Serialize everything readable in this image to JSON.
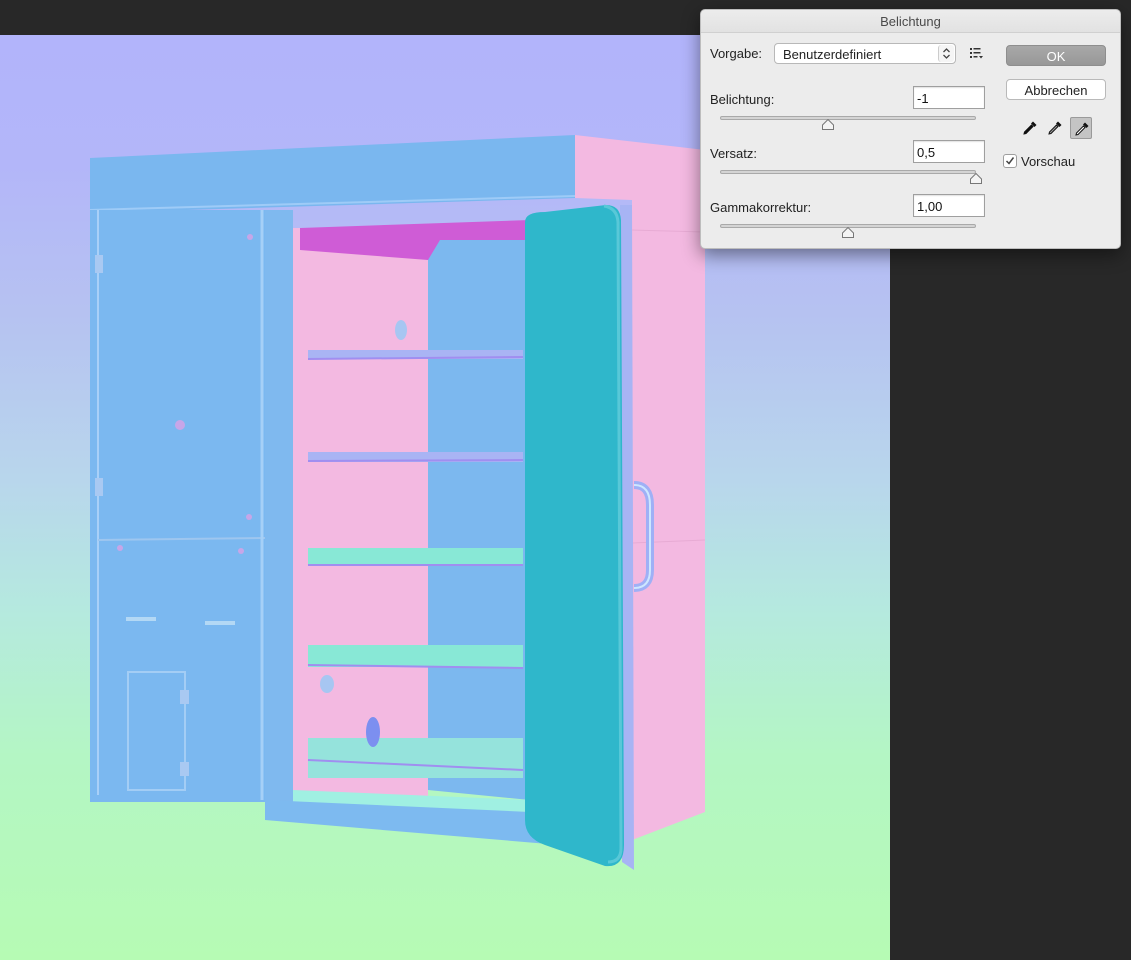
{
  "dialog": {
    "title": "Belichtung",
    "preset": {
      "label": "Vorgabe:",
      "value": "Benutzerdefiniert",
      "menu_icon": "preset-options-icon"
    },
    "exposure": {
      "label": "Belichtung:",
      "value": "-1",
      "min": -20,
      "max": 20,
      "slider_value": -1
    },
    "offset": {
      "label": "Versatz:",
      "value": "0,5",
      "min": -0.5,
      "max": 0.5,
      "slider_value": 0.5
    },
    "gamma": {
      "label": "Gammakorrektur:",
      "value": "1,00",
      "slider_position": 0.5
    },
    "buttons": {
      "ok": "OK",
      "cancel": "Abbrechen"
    },
    "eyedroppers": [
      "black-point-eyedropper-icon",
      "gray-point-eyedropper-icon",
      "white-point-eyedropper-icon"
    ],
    "preview": {
      "label": "Vorschau",
      "checked": true
    }
  },
  "colors": {
    "ok_button": "#9f9f9f",
    "selected_tool": "#c4c4c4",
    "workspace": "#282828"
  }
}
